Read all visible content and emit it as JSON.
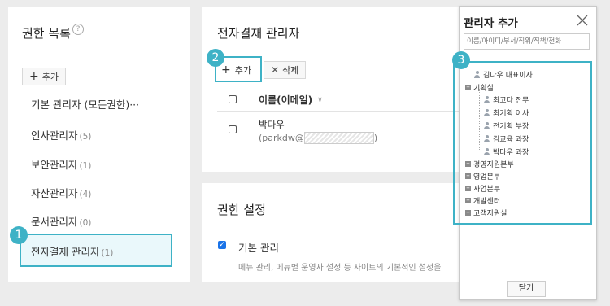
{
  "left_panel": {
    "title": "권한 목록",
    "add_label": "추가",
    "roles": [
      {
        "name": "기본 관리자 (모든권한)···",
        "count": ""
      },
      {
        "name": "인사관리자",
        "count": "(5)"
      },
      {
        "name": "보안관리자",
        "count": "(1)"
      },
      {
        "name": "자산관리자",
        "count": "(4)"
      },
      {
        "name": "문서관리자",
        "count": "(0)"
      },
      {
        "name": "전자결재 관리자",
        "count": "(1)"
      }
    ]
  },
  "center_panel": {
    "title": "전자결재 관리자",
    "add_label": "추가",
    "delete_label": "삭제",
    "column_header": "이름(이메일)",
    "rows": [
      {
        "name": "박다우",
        "email_prefix": "(parkdw@",
        "email_suffix": ")"
      }
    ]
  },
  "settings_panel": {
    "title": "권한 설정",
    "basic_label": "기본 관리",
    "basic_desc": "메뉴 관리, 메뉴별 운영자 설정 등 사이트의 기본적인 설정을"
  },
  "callouts": [
    "1",
    "2",
    "3"
  ],
  "modal": {
    "title": "관리자 추가",
    "search_placeholder": "이름/아이디/부서/직위/직책/전화",
    "close_label": "닫기",
    "tree": [
      {
        "label": "김다우 대표이사",
        "kind": "person"
      },
      {
        "label": "기획실",
        "kind": "dept-open"
      },
      {
        "label": "최고다 전무",
        "kind": "person-key"
      },
      {
        "label": "최기획 이사",
        "kind": "person"
      },
      {
        "label": "전기획 부장",
        "kind": "person"
      },
      {
        "label": "김교육 과장",
        "kind": "person"
      },
      {
        "label": "박다우 과장",
        "kind": "person"
      },
      {
        "label": "경영지원본부",
        "kind": "dept"
      },
      {
        "label": "영업본부",
        "kind": "dept"
      },
      {
        "label": "사업본부",
        "kind": "dept"
      },
      {
        "label": "개발센터",
        "kind": "dept"
      },
      {
        "label": "고객지원실",
        "kind": "dept"
      }
    ]
  },
  "colors": {
    "accent": "#3eb2c6",
    "highlight_bg": "#eaf8fb",
    "background": "#ececec"
  }
}
